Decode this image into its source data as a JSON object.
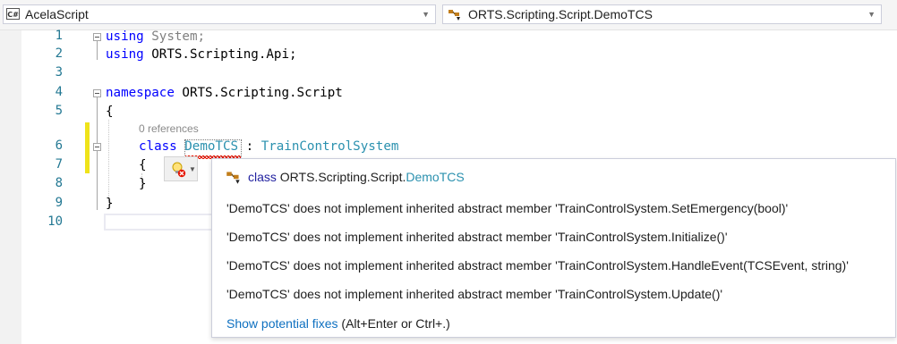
{
  "navbar": {
    "project": {
      "icon_label": "C#",
      "text": "AcelaScript"
    },
    "type_scope": {
      "text": "ORTS.Scripting.Script.DemoTCS"
    }
  },
  "editor": {
    "line_numbers": [
      "1",
      "2",
      "3",
      "4",
      "5",
      "6",
      "7",
      "8",
      "9",
      "10"
    ],
    "lines": {
      "l1_kw": "using",
      "l1_rest": " System;",
      "l2_kw": "using",
      "l2_rest": " ORTS.Scripting.Api;",
      "l4_kw": "namespace",
      "l4_rest": " ORTS.Scripting.Script",
      "l5": "{",
      "l6_kw": "class",
      "l6_name": "DemoTCS",
      "l6_sep": " : ",
      "l6_base": "TrainControlSystem",
      "l7": "{",
      "l8": "}",
      "l9": "}"
    },
    "references_label": "0 references"
  },
  "quick_info": {
    "header_keyword": "class",
    "header_namespace": "ORTS.Scripting.Script.",
    "header_type": "DemoTCS",
    "errors": [
      "'DemoTCS' does not implement inherited abstract member 'TrainControlSystem.SetEmergency(bool)'",
      "'DemoTCS' does not implement inherited abstract member 'TrainControlSystem.Initialize()'",
      "'DemoTCS' does not implement inherited abstract member 'TrainControlSystem.HandleEvent(TCSEvent, string)'",
      "'DemoTCS' does not implement inherited abstract member 'TrainControlSystem.Update()'"
    ],
    "fix_link": "Show potential fixes",
    "fix_shortcut": " (Alt+Enter or Ctrl+.)"
  }
}
